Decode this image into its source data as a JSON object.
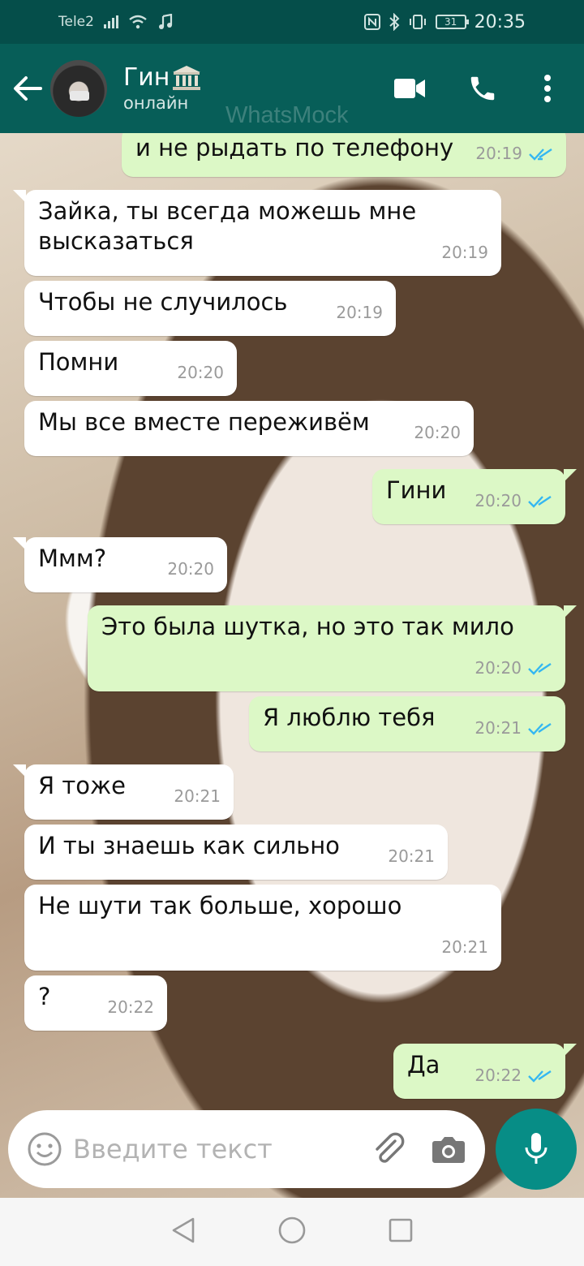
{
  "status_bar": {
    "carrier": "Tele2",
    "battery": "31",
    "time": "20:35"
  },
  "header": {
    "contact_name": "Гин",
    "contact_status": "онлайн",
    "watermark": "WhatsMock",
    "icons": {
      "back": "arrow-left-icon",
      "video": "video-camera-icon",
      "call": "phone-icon",
      "menu": "more-vert-icon"
    },
    "name_emoji": "classical-building-icon"
  },
  "messages": [
    {
      "dir": "out",
      "text": "и не рыдать по телефону",
      "time": "20:19",
      "read": true
    },
    {
      "dir": "in",
      "text": "Зайка, ты всегда можешь мне\nвысказаться",
      "time": "20:19"
    },
    {
      "dir": "in",
      "text": "Чтобы не случилось",
      "time": "20:19"
    },
    {
      "dir": "in",
      "text": "Помни",
      "time": "20:20"
    },
    {
      "dir": "in",
      "text": "Мы все вместе переживём",
      "time": "20:20"
    },
    {
      "dir": "out",
      "text": "Гини",
      "time": "20:20",
      "read": true
    },
    {
      "dir": "in",
      "text": "Ммм?",
      "time": "20:20"
    },
    {
      "dir": "out",
      "text": "Это была шутка, но это так мило",
      "time": "20:20",
      "read": true
    },
    {
      "dir": "out",
      "text": "Я люблю тебя",
      "time": "20:21",
      "read": true
    },
    {
      "dir": "in",
      "text": "Я тоже",
      "time": "20:21"
    },
    {
      "dir": "in",
      "text": "И ты знаешь как сильно",
      "time": "20:21"
    },
    {
      "dir": "in",
      "text": "Не шути так больше, хорошо",
      "time": "20:21"
    },
    {
      "dir": "in",
      "text": "?",
      "time": "20:22"
    },
    {
      "dir": "out",
      "text": "Да",
      "time": "20:22",
      "read": true
    }
  ],
  "input": {
    "placeholder": "Введите текст",
    "emoji_icon": "emoji-icon",
    "attach_icon": "paperclip-icon",
    "camera_icon": "camera-icon",
    "mic_icon": "microphone-icon"
  },
  "colors": {
    "header": "#075e58",
    "status_bar": "#054e4a",
    "outgoing_bubble": "#dcf8c6",
    "incoming_bubble": "#ffffff",
    "read_ticks": "#34b7f1",
    "mic_button": "#078d86"
  }
}
